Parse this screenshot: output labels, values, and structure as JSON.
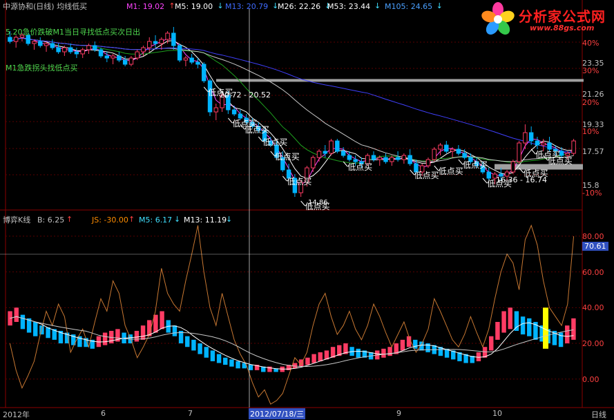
{
  "header": {
    "title": "中源协和(日线) 均线低买",
    "ma_labels": [
      {
        "text": "M1: 19.02",
        "color": "#ff44ff",
        "arrow": "up"
      },
      {
        "text": "M5: 19.00",
        "color": "#ffffff",
        "arrow": "down"
      },
      {
        "text": "M13: 20.79",
        "color": "#3f6bff",
        "arrow": "down"
      },
      {
        "text": "M26: 22.26",
        "color": "#ffffff",
        "arrow": "down"
      },
      {
        "text": "M53: 23.44",
        "color": "#ffffff",
        "arrow": "down"
      },
      {
        "text": "M105: 24.65",
        "color": "#4aa0ff",
        "arrow": "down"
      }
    ]
  },
  "annotations": {
    "line1": "5.20急价跌破M1当日寻找低点买次日出",
    "line2": "M1急跌拐头找低点买",
    "range_box_1": "20.72 - 20.52",
    "range_box_2": "16.36 - 16.74",
    "buy_label": "低点买",
    "partial_low": "14.86"
  },
  "sub_header": {
    "title": "博弈K线",
    "b_label": "B: 6.25",
    "b_arrow": "up",
    "js_label": "JS: -30.00",
    "js_arrow": "up",
    "m5_label": "M5: 6.17",
    "m5_arrow": "down",
    "m13_label": "M13: 11.19",
    "m13_arrow": "down"
  },
  "right_axis_top": [
    {
      "text": "40%",
      "color": "#ff4040"
    },
    {
      "text": "23.35",
      "color": "#c0c0c0"
    },
    {
      "text": "30%",
      "color": "#ff4040"
    },
    {
      "text": "21.26",
      "color": "#c0c0c0"
    },
    {
      "text": "20%",
      "color": "#ff4040"
    },
    {
      "text": "19.33",
      "color": "#c0c0c0"
    },
    {
      "text": "10%",
      "color": "#ff4040"
    },
    {
      "text": "17.57",
      "color": "#c0c0c0"
    },
    {
      "text": "15.8",
      "color": "#c0c0c0"
    },
    {
      "text": "-10%",
      "color": "#ff4040"
    }
  ],
  "right_axis_bottom": [
    {
      "text": "80.00"
    },
    {
      "text": "70.61",
      "highlight": true
    },
    {
      "text": "60.00"
    },
    {
      "text": "40.00"
    },
    {
      "text": "20.00"
    },
    {
      "text": "0.00"
    }
  ],
  "bottom_axis": {
    "year_label": "2012年",
    "month_6": "6",
    "month_7": "7",
    "cursor_date": "2012/07/18/三",
    "month_9": "9",
    "month_10": "10",
    "period": "日线"
  },
  "logo": {
    "title": "分析家公式网",
    "url": "www.88gs.com"
  },
  "colors": {
    "up": "#ff3c64",
    "down": "#00b4ff",
    "ma5": "#ffffff",
    "ma13": "#ff44ff",
    "ma26": "#1ea01e",
    "ma53": "#c8c8c8",
    "ma105": "#4040ff",
    "oscillator": "#c87832",
    "highlight_bar": "#ffff00"
  },
  "chart_data": {
    "type": "candlestick",
    "price_panel": {
      "ylim": [
        14.8,
        23.6
      ],
      "reference_lines": [
        20.72,
        16.55
      ],
      "candles": [
        [
          22.8,
          23.1,
          22.5,
          22.6
        ],
        [
          22.6,
          22.9,
          22.3,
          22.8
        ],
        [
          22.8,
          23.0,
          22.6,
          22.9
        ],
        [
          22.9,
          23.0,
          22.4,
          22.5
        ],
        [
          22.5,
          22.7,
          22.2,
          22.6
        ],
        [
          22.6,
          22.8,
          22.3,
          22.4
        ],
        [
          22.4,
          22.6,
          22.1,
          22.5
        ],
        [
          22.5,
          22.7,
          22.2,
          22.3
        ],
        [
          22.3,
          22.5,
          22.0,
          22.1
        ],
        [
          22.1,
          22.4,
          21.9,
          22.3
        ],
        [
          22.3,
          22.5,
          22.0,
          22.1
        ],
        [
          22.1,
          22.3,
          21.8,
          22.0
        ],
        [
          22.0,
          22.3,
          21.8,
          22.2
        ],
        [
          22.2,
          22.5,
          22.0,
          22.4
        ],
        [
          22.4,
          22.6,
          22.1,
          22.2
        ],
        [
          22.2,
          22.3,
          21.8,
          21.9
        ],
        [
          21.9,
          22.1,
          21.6,
          21.8
        ],
        [
          21.8,
          22.0,
          21.5,
          21.9
        ],
        [
          21.9,
          22.1,
          21.6,
          21.7
        ],
        [
          21.7,
          21.9,
          21.4,
          21.5
        ],
        [
          21.5,
          21.9,
          21.4,
          21.8
        ],
        [
          21.8,
          22.2,
          21.7,
          22.1
        ],
        [
          22.1,
          22.4,
          21.9,
          22.3
        ],
        [
          22.3,
          22.8,
          22.1,
          22.6
        ],
        [
          22.6,
          22.9,
          22.3,
          22.5
        ],
        [
          22.5,
          22.8,
          22.2,
          22.7
        ],
        [
          22.7,
          23.1,
          22.5,
          23.0
        ],
        [
          23.0,
          23.3,
          22.2,
          22.4
        ],
        [
          22.4,
          22.5,
          21.6,
          21.7
        ],
        [
          21.7,
          21.9,
          21.4,
          21.8
        ],
        [
          21.8,
          22.0,
          21.5,
          21.6
        ],
        [
          21.6,
          21.8,
          21.3,
          21.5
        ],
        [
          21.5,
          21.6,
          20.6,
          20.7
        ],
        [
          20.7,
          20.8,
          19.0,
          19.2
        ],
        [
          19.2,
          19.6,
          18.8,
          19.4
        ],
        [
          19.4,
          20.1,
          19.2,
          20.0
        ],
        [
          20.0,
          20.2,
          19.1,
          19.3
        ],
        [
          19.3,
          19.5,
          19.0,
          19.1
        ],
        [
          19.1,
          19.3,
          18.8,
          18.9
        ],
        [
          18.9,
          19.1,
          18.6,
          18.7
        ],
        [
          18.7,
          18.9,
          18.4,
          18.5
        ],
        [
          18.5,
          18.7,
          18.2,
          18.3
        ],
        [
          18.3,
          18.4,
          17.7,
          17.8
        ],
        [
          17.8,
          18.0,
          17.5,
          17.6
        ],
        [
          17.6,
          17.8,
          16.9,
          17.0
        ],
        [
          17.0,
          17.3,
          16.3,
          16.4
        ],
        [
          16.4,
          16.7,
          15.9,
          16.0
        ],
        [
          16.0,
          16.2,
          15.1,
          15.3
        ],
        [
          15.3,
          15.9,
          15.1,
          15.8
        ],
        [
          15.8,
          16.6,
          15.6,
          16.5
        ],
        [
          16.5,
          17.1,
          16.3,
          17.0
        ],
        [
          17.0,
          17.4,
          16.8,
          17.3
        ],
        [
          17.3,
          17.6,
          17.0,
          17.2
        ],
        [
          17.2,
          17.9,
          17.1,
          17.8
        ],
        [
          17.8,
          17.9,
          17.2,
          17.3
        ],
        [
          17.3,
          17.5,
          17.0,
          17.1
        ],
        [
          17.1,
          17.3,
          16.8,
          16.9
        ],
        [
          16.9,
          17.1,
          16.6,
          16.8
        ],
        [
          16.8,
          17.0,
          16.5,
          16.7
        ],
        [
          16.7,
          17.2,
          16.6,
          17.1
        ],
        [
          17.1,
          17.3,
          16.8,
          16.9
        ],
        [
          16.9,
          17.1,
          16.6,
          17.0
        ],
        [
          17.0,
          17.2,
          16.7,
          16.8
        ],
        [
          16.8,
          17.1,
          16.6,
          17.0
        ],
        [
          17.0,
          17.3,
          16.8,
          16.9
        ],
        [
          16.9,
          17.2,
          16.7,
          17.1
        ],
        [
          17.1,
          17.4,
          16.6,
          16.7
        ],
        [
          16.7,
          16.9,
          16.2,
          16.3
        ],
        [
          16.3,
          16.7,
          16.1,
          16.6
        ],
        [
          16.6,
          17.0,
          16.5,
          16.9
        ],
        [
          16.9,
          17.5,
          16.8,
          17.4
        ],
        [
          17.4,
          17.7,
          17.1,
          17.6
        ],
        [
          17.6,
          17.8,
          17.2,
          17.3
        ],
        [
          17.3,
          17.5,
          17.0,
          17.4
        ],
        [
          17.4,
          17.6,
          17.1,
          17.2
        ],
        [
          17.2,
          17.4,
          16.9,
          17.0
        ],
        [
          17.0,
          17.2,
          16.7,
          16.8
        ],
        [
          16.8,
          17.0,
          16.5,
          16.6
        ],
        [
          16.6,
          16.8,
          16.2,
          16.3
        ],
        [
          16.3,
          16.5,
          15.9,
          16.0
        ],
        [
          16.0,
          16.3,
          15.7,
          16.2
        ],
        [
          16.2,
          16.5,
          15.9,
          16.1
        ],
        [
          16.1,
          16.4,
          15.9,
          16.3
        ],
        [
          16.3,
          16.9,
          16.2,
          16.8
        ],
        [
          16.8,
          17.8,
          16.7,
          17.7
        ],
        [
          17.7,
          18.6,
          17.4,
          18.2
        ],
        [
          18.2,
          18.5,
          17.6,
          17.8
        ],
        [
          17.8,
          18.0,
          17.4,
          17.6
        ],
        [
          17.6,
          17.9,
          17.3,
          17.7
        ],
        [
          17.7,
          18.0,
          17.3,
          17.4
        ],
        [
          17.4,
          17.6,
          17.1,
          17.3
        ],
        [
          17.3,
          17.5,
          17.0,
          17.1
        ],
        [
          17.1,
          17.3,
          16.9,
          17.2
        ],
        [
          17.2,
          17.9,
          17.1,
          17.8
        ]
      ]
    },
    "indicator_panel": {
      "ylim": [
        -14,
        90
      ],
      "reference_line": 70.61,
      "ticks": [
        0,
        20,
        40,
        60,
        80
      ],
      "oscillator": [
        20,
        5,
        -5,
        2,
        10,
        25,
        38,
        30,
        42,
        35,
        15,
        22,
        28,
        18,
        32,
        45,
        38,
        55,
        48,
        30,
        22,
        12,
        18,
        25,
        38,
        62,
        48,
        42,
        38,
        55,
        70,
        86,
        60,
        40,
        30,
        48,
        35,
        22,
        14,
        8,
        -2,
        -10,
        -6,
        -14,
        -12,
        -8,
        2,
        12,
        8,
        15,
        30,
        42,
        48,
        35,
        25,
        30,
        38,
        28,
        22,
        30,
        42,
        35,
        26,
        18,
        25,
        32,
        22,
        15,
        20,
        28,
        45,
        38,
        30,
        22,
        18,
        25,
        35,
        26,
        18,
        28,
        45,
        60,
        70,
        65,
        50,
        78,
        86,
        75,
        55,
        40,
        35,
        30,
        42,
        80
      ],
      "bars": [
        [
          30,
          38
        ],
        [
          32,
          40
        ],
        [
          28,
          36
        ],
        [
          26,
          34
        ],
        [
          24,
          32
        ],
        [
          25,
          30
        ],
        [
          23,
          29
        ],
        [
          22,
          28
        ],
        [
          20,
          27
        ],
        [
          20,
          26
        ],
        [
          19,
          25
        ],
        [
          18,
          24
        ],
        [
          18,
          23
        ],
        [
          17,
          22
        ],
        [
          18,
          24
        ],
        [
          19,
          26
        ],
        [
          20,
          27
        ],
        [
          21,
          28
        ],
        [
          20,
          26
        ],
        [
          20,
          25
        ],
        [
          21,
          27
        ],
        [
          22,
          30
        ],
        [
          24,
          33
        ],
        [
          26,
          36
        ],
        [
          28,
          38
        ],
        [
          26,
          33
        ],
        [
          24,
          30
        ],
        [
          20,
          27
        ],
        [
          18,
          24
        ],
        [
          16,
          22
        ],
        [
          14,
          20
        ],
        [
          12,
          18
        ],
        [
          10,
          16
        ],
        [
          9,
          14
        ],
        [
          8,
          12
        ],
        [
          7,
          11
        ],
        [
          6,
          10
        ],
        [
          6,
          9
        ],
        [
          5,
          8
        ],
        [
          5,
          8
        ],
        [
          4,
          7
        ],
        [
          4,
          7
        ],
        [
          4,
          6
        ],
        [
          4,
          7
        ],
        [
          5,
          8
        ],
        [
          6,
          9
        ],
        [
          7,
          11
        ],
        [
          8,
          12
        ],
        [
          9,
          14
        ],
        [
          10,
          15
        ],
        [
          11,
          16
        ],
        [
          12,
          18
        ],
        [
          13,
          19
        ],
        [
          14,
          20
        ],
        [
          13,
          18
        ],
        [
          12,
          17
        ],
        [
          12,
          16
        ],
        [
          11,
          15
        ],
        [
          11,
          16
        ],
        [
          12,
          17
        ],
        [
          13,
          18
        ],
        [
          14,
          20
        ],
        [
          16,
          22
        ],
        [
          18,
          24
        ],
        [
          17,
          22
        ],
        [
          16,
          21
        ],
        [
          15,
          20
        ],
        [
          14,
          19
        ],
        [
          13,
          18
        ],
        [
          12,
          17
        ],
        [
          11,
          16
        ],
        [
          10,
          15
        ],
        [
          9,
          14
        ],
        [
          9,
          13
        ],
        [
          10,
          15
        ],
        [
          12,
          18
        ],
        [
          16,
          24
        ],
        [
          22,
          32
        ],
        [
          26,
          38
        ],
        [
          28,
          40
        ],
        [
          27,
          38
        ],
        [
          25,
          35
        ],
        [
          24,
          34
        ],
        [
          22,
          32
        ],
        [
          21,
          30
        ],
        [
          20,
          28
        ],
        [
          19,
          27
        ],
        [
          18,
          26
        ],
        [
          20,
          30
        ],
        [
          22,
          34
        ]
      ]
    }
  }
}
